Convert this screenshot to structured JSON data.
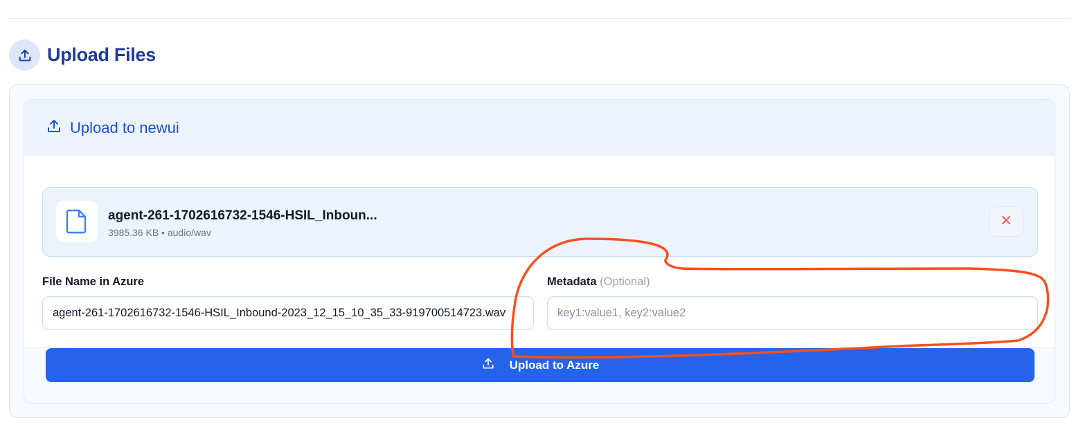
{
  "page": {
    "title": "Upload Files",
    "header_icon": "upload-icon"
  },
  "card": {
    "title": "Upload to newui",
    "title_icon": "upload-icon"
  },
  "file": {
    "name": "agent-261-1702616732-1546-HSIL_Inboun...",
    "meta": "3985.36 KB • audio/wav",
    "icon": "file-icon",
    "remove_icon": "close-icon",
    "remove_color": "#ef4444"
  },
  "fields": {
    "file_name_label": "File Name in Azure",
    "file_name_value": "agent-261-1702616732-1546-HSIL_Inbound-2023_12_15_10_35_33-919700514723.wav",
    "metadata_label": "Metadata",
    "metadata_optional": "(Optional)",
    "metadata_placeholder": "key1:value1, key2:value2",
    "metadata_value": ""
  },
  "actions": {
    "upload_label": "Upload to Azure",
    "upload_icon": "upload-icon"
  },
  "colors": {
    "accent": "#2563eb",
    "title": "#1e3a9a",
    "annotation": "#f4511e"
  },
  "annotation": {
    "shape": "hand-drawn-loop",
    "target": "metadata-field"
  }
}
